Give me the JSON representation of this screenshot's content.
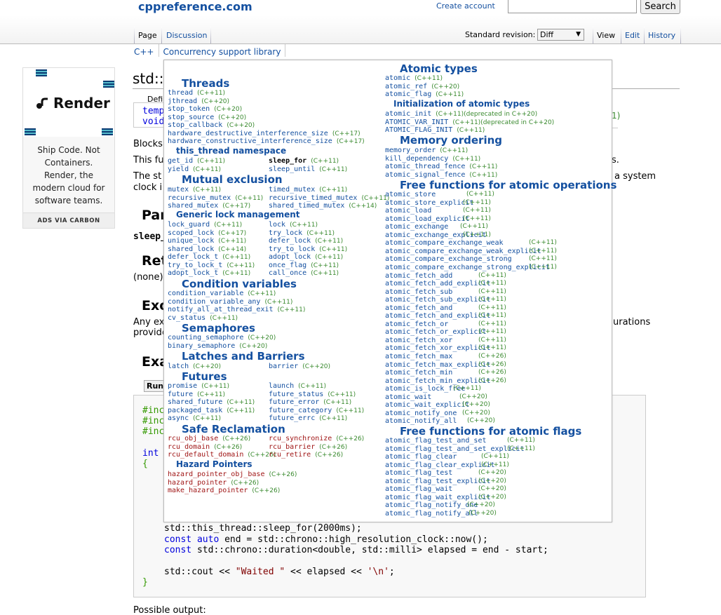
{
  "header": {
    "site_title": "cppreference.com",
    "create_account": "Create account",
    "search_button": "Search"
  },
  "tabs": {
    "page": "Page",
    "discussion": "Discussion",
    "standard_revision_label": "Standard revision:",
    "revision_value": "Diff",
    "view": "View",
    "edit": "Edit",
    "history": "History"
  },
  "breadcrumb": [
    "C++",
    "Concurrency support library"
  ],
  "ad": {
    "brand": "Render",
    "text": "Ship Code. Not Containers. Render, the modern cloud for software teams.",
    "via": "ADS VIA CARBON"
  },
  "page": {
    "title_fragment": "std::t",
    "defined_fragment": "Defi",
    "decl1": "temp",
    "decl2": "void",
    "decl_ver": "1)",
    "p1": "Blocks",
    "p2": "This fu",
    "p2_end": "s.",
    "p3": "The st",
    "p3_end": "a system",
    "p3b": "clock i",
    "h_params": "Par",
    "param": "sleep_",
    "h_return": "Ret",
    "return_val": "(none)",
    "h_except": "Exc",
    "except1": "Any ex",
    "except1_end": "urations",
    "except2": "provide",
    "h_example": "Exa",
    "run_button": "Run",
    "possible_output": "Possible output:"
  },
  "code": {
    "l1": "#inc",
    "l2": "#inc",
    "l3": "#inc",
    "l4_kw": "int",
    "l5": "{",
    "l6": "std::this_thread::sleep_for(2000ms);",
    "l7_a": "const",
    "l7_b": "auto",
    "l7_c": "end = std::chrono::high_resolution_clock::now();",
    "l8_a": "const",
    "l8_b": "std::chrono::duration<double, std::milli> elapsed = end - start;",
    "l9_a": "std::cout << ",
    "l9_str": "\"Waited \"",
    "l9_b": " << elapsed << ",
    "l9_chr": "'\\n'",
    "l9_c": ";",
    "l10": "}"
  },
  "overlay": {
    "threads": {
      "heading": "Threads",
      "items": [
        [
          "thread",
          "(C++11)"
        ],
        [
          "jthread",
          "(C++20)"
        ],
        [
          "stop_token",
          "(C++20)"
        ],
        [
          "stop_source",
          "(C++20)"
        ],
        [
          "stop_callback",
          "(C++20)"
        ],
        [
          "hardware_destructive_interference_size",
          "(C++17)"
        ],
        [
          "hardware_constructive_interference_size",
          "(C++17)"
        ]
      ]
    },
    "this_thread": {
      "heading": "this_thread namespace",
      "left": [
        [
          "get_id",
          "(C++11)"
        ],
        [
          "yield",
          "(C++11)"
        ]
      ],
      "right": [
        [
          "sleep_for",
          "(C++11)"
        ],
        [
          "sleep_until",
          "(C++11)"
        ]
      ]
    },
    "mutex": {
      "heading": "Mutual exclusion",
      "left": [
        [
          "mutex",
          "(C++11)"
        ],
        [
          "recursive_mutex",
          "(C++11)"
        ],
        [
          "shared_mutex",
          "(C++17)"
        ]
      ],
      "right": [
        [
          "timed_mutex",
          "(C++11)"
        ],
        [
          "recursive_timed_mutex",
          "(C++11)"
        ],
        [
          "shared_timed_mutex",
          "(C++14)"
        ]
      ]
    },
    "locks": {
      "heading": "Generic lock management",
      "left": [
        [
          "lock_guard",
          "(C++11)"
        ],
        [
          "scoped_lock",
          "(C++17)"
        ],
        [
          "unique_lock",
          "(C++11)"
        ],
        [
          "shared_lock",
          "(C++14)"
        ],
        [
          "defer_lock_t",
          "(C++11)"
        ],
        [
          "try_to_lock_t",
          "(C++11)"
        ],
        [
          "adopt_lock_t",
          "(C++11)"
        ]
      ],
      "right": [
        [
          "lock",
          "(C++11)"
        ],
        [
          "try_lock",
          "(C++11)"
        ],
        [
          "defer_lock",
          "(C++11)"
        ],
        [
          "try_to_lock",
          "(C++11)"
        ],
        [
          "adopt_lock",
          "(C++11)"
        ],
        [
          "once_flag",
          "(C++11)"
        ],
        [
          "call_once",
          "(C++11)"
        ]
      ]
    },
    "condvar": {
      "heading": "Condition variables",
      "items": [
        [
          "condition_variable",
          "(C++11)"
        ],
        [
          "condition_variable_any",
          "(C++11)"
        ],
        [
          "notify_all_at_thread_exit",
          "(C++11)"
        ],
        [
          "cv_status",
          "(C++11)"
        ]
      ]
    },
    "semaphores": {
      "heading": "Semaphores",
      "items": [
        [
          "counting_semaphore",
          "(C++20)"
        ],
        [
          "binary_semaphore",
          "(C++20)"
        ]
      ]
    },
    "latches": {
      "heading": "Latches and Barriers",
      "left": [
        [
          "latch",
          "(C++20)"
        ]
      ],
      "right": [
        [
          "barrier",
          "(C++20)"
        ]
      ]
    },
    "futures": {
      "heading": "Futures",
      "left": [
        [
          "promise",
          "(C++11)"
        ],
        [
          "future",
          "(C++11)"
        ],
        [
          "shared_future",
          "(C++11)"
        ],
        [
          "packaged_task",
          "(C++11)"
        ],
        [
          "async",
          "(C++11)"
        ]
      ],
      "right": [
        [
          "launch",
          "(C++11)"
        ],
        [
          "future_status",
          "(C++11)"
        ],
        [
          "future_error",
          "(C++11)"
        ],
        [
          "future_category",
          "(C++11)"
        ],
        [
          "future_errc",
          "(C++11)"
        ]
      ]
    },
    "reclamation": {
      "heading": "Safe Reclamation",
      "left": [
        [
          "rcu_obj_base",
          "(C++26)"
        ],
        [
          "rcu_domain",
          "(C++26)"
        ],
        [
          "rcu_default_domain",
          "(C++26)"
        ]
      ],
      "right": [
        [
          "rcu_synchronize",
          "(C++26)"
        ],
        [
          "rcu_barrier",
          "(C++26)"
        ],
        [
          "rcu_retire",
          "(C++26)"
        ]
      ]
    },
    "hazard": {
      "heading": "Hazard Pointers",
      "items": [
        [
          "hazard_pointer_obj_base",
          "(C++26)"
        ],
        [
          "hazard_pointer",
          "(C++26)"
        ],
        [
          "make_hazard_pointer",
          "(C++26)"
        ]
      ]
    },
    "atomic_types": {
      "heading": "Atomic types",
      "items": [
        [
          "atomic",
          "(C++11)"
        ],
        [
          "atomic_ref",
          "(C++20)"
        ],
        [
          "atomic_flag",
          "(C++11)"
        ]
      ]
    },
    "atomic_init": {
      "heading": "Initialization of atomic types",
      "items": [
        [
          "atomic_init",
          "(C++11)(deprecated in C++20)"
        ],
        [
          "ATOMIC_VAR_INIT",
          "(C++11)(deprecated in C++20)"
        ],
        [
          "ATOMIC_FLAG_INIT",
          "(C++11)"
        ]
      ]
    },
    "memory_order": {
      "heading": "Memory ordering",
      "items": [
        [
          "memory_order",
          "(C++11)"
        ],
        [
          "kill_dependency",
          "(C++11)"
        ],
        [
          "atomic_thread_fence",
          "(C++11)"
        ],
        [
          "atomic_signal_fence",
          "(C++11)"
        ]
      ]
    },
    "atomic_ops": {
      "heading": "Free functions for atomic operations",
      "items": [
        [
          "atomic_store",
          "(C++11)"
        ],
        [
          "atomic_store_explicit",
          "(C++11)"
        ],
        [
          "atomic_load",
          "(C++11)"
        ],
        [
          "atomic_load_explicit",
          "(C++11)"
        ],
        [
          "atomic_exchange",
          "(C++11)"
        ],
        [
          "atomic_exchange_explicit",
          "(C++11)"
        ],
        [
          "atomic_compare_exchange_weak",
          "(C++11)"
        ],
        [
          "atomic_compare_exchange_weak_explicit",
          "(C++11)"
        ],
        [
          "atomic_compare_exchange_strong",
          "(C++11)"
        ],
        [
          "atomic_compare_exchange_strong_explicit",
          "(C++11)"
        ],
        [
          "atomic_fetch_add",
          "(C++11)"
        ],
        [
          "atomic_fetch_add_explicit",
          "(C++11)"
        ],
        [
          "atomic_fetch_sub",
          "(C++11)"
        ],
        [
          "atomic_fetch_sub_explicit",
          "(C++11)"
        ],
        [
          "atomic_fetch_and",
          "(C++11)"
        ],
        [
          "atomic_fetch_and_explicit",
          "(C++11)"
        ],
        [
          "atomic_fetch_or",
          "(C++11)"
        ],
        [
          "atomic_fetch_or_explicit",
          "(C++11)"
        ],
        [
          "atomic_fetch_xor",
          "(C++11)"
        ],
        [
          "atomic_fetch_xor_explicit",
          "(C++11)"
        ],
        [
          "atomic_fetch_max",
          "(C++26)"
        ],
        [
          "atomic_fetch_max_explicit",
          "(C++26)"
        ],
        [
          "atomic_fetch_min",
          "(C++26)"
        ],
        [
          "atomic_fetch_min_explicit",
          "(C++26)"
        ],
        [
          "atomic_is_lock_free",
          "(C++11)"
        ],
        [
          "atomic_wait",
          "(C++20)"
        ],
        [
          "atomic_wait_explicit",
          "(C++20)"
        ],
        [
          "atomic_notify_one",
          "(C++20)"
        ],
        [
          "atomic_notify_all",
          "(C++20)"
        ]
      ]
    },
    "atomic_flags": {
      "heading": "Free functions for atomic flags",
      "items": [
        [
          "atomic_flag_test_and_set",
          "(C++11)"
        ],
        [
          "atomic_flag_test_and_set_explicit",
          "(C++11)"
        ],
        [
          "atomic_flag_clear",
          "(C++11)"
        ],
        [
          "atomic_flag_clear_explicit",
          "(C++11)"
        ],
        [
          "atomic_flag_test",
          "(C++20)"
        ],
        [
          "atomic_flag_test_explicit",
          "(C++20)"
        ],
        [
          "atomic_flag_wait",
          "(C++20)"
        ],
        [
          "atomic_flag_wait_explicit",
          "(C++20)"
        ],
        [
          "atomic_flag_notify_one",
          "(C++20)"
        ],
        [
          "atomic_flag_notify_all",
          "(C++20)"
        ]
      ]
    }
  }
}
